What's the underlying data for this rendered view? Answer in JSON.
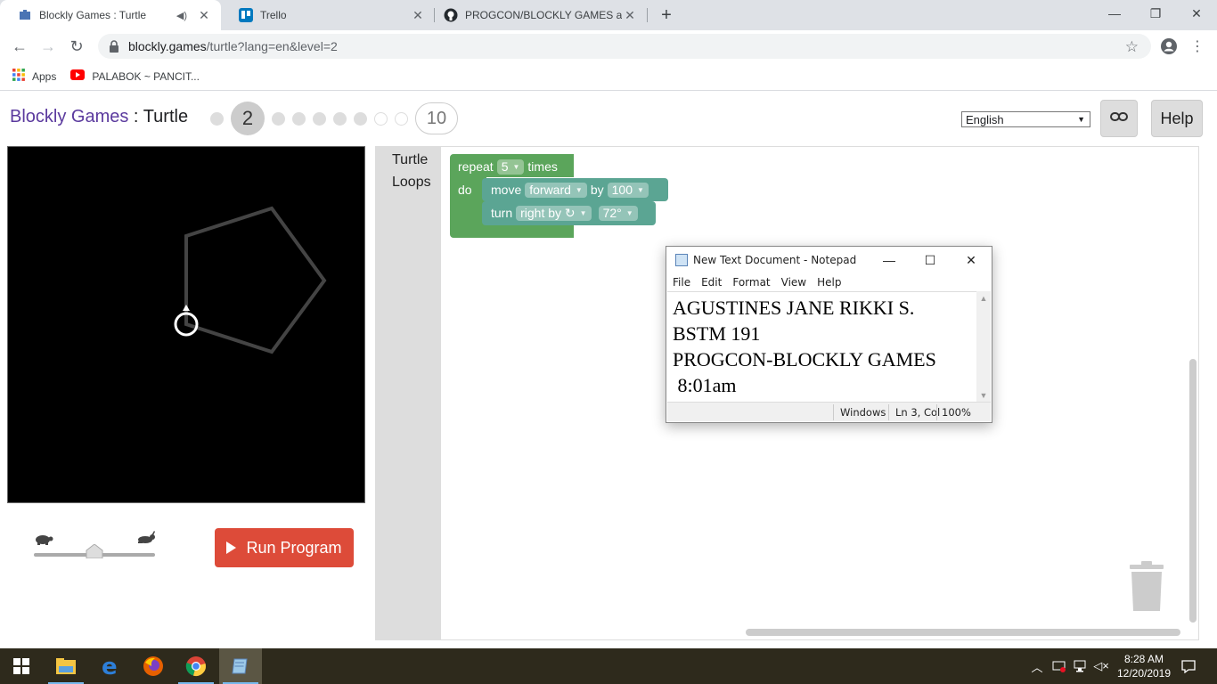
{
  "browser": {
    "tabs": [
      {
        "title": "Blockly Games : Turtle",
        "icon": "blockly-puzzle-icon",
        "audio": true
      },
      {
        "title": "Trello",
        "icon": "trello-icon"
      },
      {
        "title": "PROGCON/BLOCKLY GAMES at r",
        "icon": "github-icon"
      }
    ],
    "url_host": "blockly.games",
    "url_path": "/turtle?lang=en&level=2",
    "bookmarks": [
      {
        "label": "Apps",
        "icon": "apps-grid-icon"
      },
      {
        "label": "PALABOK ~ PANCIT...",
        "icon": "youtube-icon"
      }
    ]
  },
  "game": {
    "brand": "Blockly Games",
    "separator": " : ",
    "name": "Turtle",
    "current_level": "2",
    "last_level": "10",
    "language": "English",
    "help_label": "Help",
    "run_label": "Run Program",
    "toolbox": [
      "Turtle",
      "Loops"
    ],
    "speed_fraction": 0.5
  },
  "blocks": {
    "repeat": {
      "label": "repeat",
      "count": "5",
      "suffix": "times",
      "do": "do"
    },
    "move": {
      "label": "move",
      "direction": "forward",
      "by": "by",
      "distance": "100"
    },
    "turn": {
      "label": "turn",
      "direction": "right by ↻",
      "angle": "72°"
    },
    "colors": {
      "loop": "#5ba55b",
      "turtle": "#5ba593"
    }
  },
  "notepad": {
    "title": "New Text Document - Notepad",
    "menu": [
      "File",
      "Edit",
      "Format",
      "View",
      "Help"
    ],
    "lines": [
      "AGUSTINES JANE RIKKI S.",
      "BSTM 191",
      "PROGCON-BLOCKLY GAMES",
      " 8:01am"
    ],
    "status": {
      "eol": "Windows",
      "position": "Ln 3, Col",
      "zoom": "100%"
    }
  },
  "taskbar": {
    "apps": [
      "windows-start-icon",
      "file-explorer-icon",
      "edge-icon",
      "firefox-icon",
      "chrome-icon",
      "notepad-icon"
    ],
    "time": "8:28 AM",
    "date": "12/20/2019"
  }
}
